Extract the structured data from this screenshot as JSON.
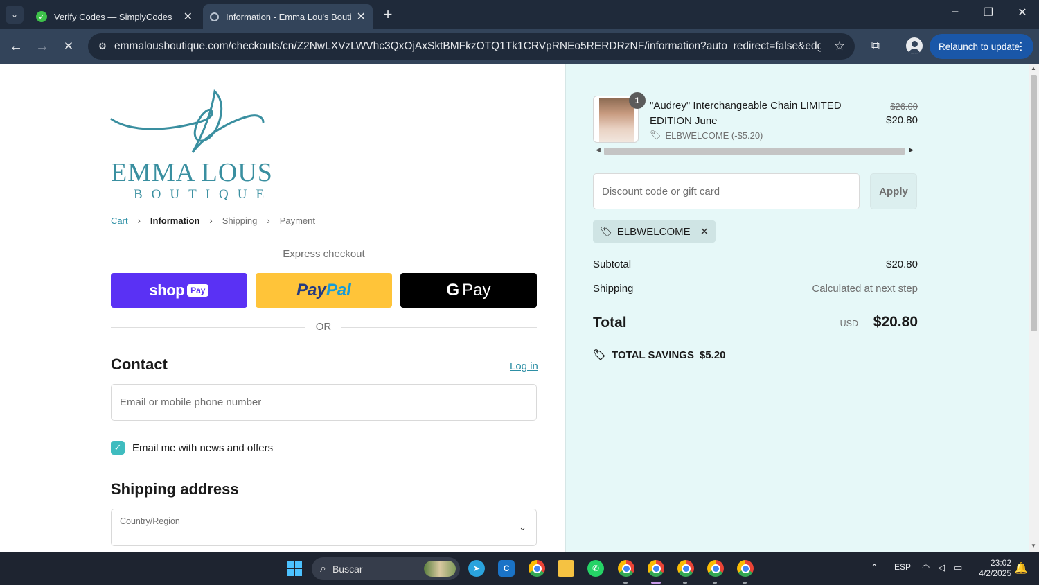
{
  "browser": {
    "tabs": [
      {
        "title": "Verify Codes — SimplyCodes",
        "active": false
      },
      {
        "title": "Information - Emma Lou's Boutique",
        "active": true
      }
    ],
    "url": "emmalousboutique.com/checkouts/cn/Z2NwLXVzLWVhc3QxOjAxSktBMFkzOTQ1Tk1CRVpRNEo5RERDRzNF/information?auto_redirect=false&edge_redirec...",
    "relaunch_label": "Relaunch to update"
  },
  "brand": {
    "name": "EMMA LOUS",
    "sub": "BOUTIQUE",
    "color": "#3a8fa0"
  },
  "breadcrumb": {
    "cart": "Cart",
    "information": "Information",
    "shipping": "Shipping",
    "payment": "Payment"
  },
  "express": {
    "title": "Express checkout",
    "shop_label": "shop",
    "shop_pay_badge": "Pay",
    "paypal_pay": "Pay",
    "paypal_pal": "Pal",
    "gpay_g": "G",
    "gpay_label": "Pay",
    "or_label": "OR"
  },
  "contact": {
    "heading": "Contact",
    "login_label": "Log in",
    "email_placeholder": "Email or mobile phone number",
    "news_label": "Email me with news and offers",
    "news_checked": true
  },
  "shipping_address": {
    "heading": "Shipping address",
    "country_label": "Country/Region"
  },
  "order": {
    "item": {
      "title": "\"Audrey\" Interchangeable Chain LIMITED EDITION June",
      "quantity": "1",
      "discount_line": "ELBWELCOME (-$5.20)",
      "price_original": "$26.00",
      "price_final": "$20.80"
    },
    "discount_placeholder": "Discount code or gift card",
    "apply_label": "Apply",
    "applied_code": "ELBWELCOME",
    "subtotal_label": "Subtotal",
    "subtotal_value": "$20.80",
    "shipping_label": "Shipping",
    "shipping_value": "Calculated at next step",
    "total_label": "Total",
    "total_currency": "USD",
    "total_value": "$20.80",
    "savings_label": "TOTAL SAVINGS",
    "savings_value": "$5.20"
  },
  "taskbar": {
    "search_label": "Buscar",
    "language": "ESP",
    "time": "23:02",
    "date": "4/2/2025"
  },
  "colors": {
    "accent": "#2d8fa5",
    "checkbox": "#3fbcbf",
    "shoppay": "#5a31f4",
    "paypal": "#ffc439",
    "sidebar_bg": "#e6f8f8"
  }
}
